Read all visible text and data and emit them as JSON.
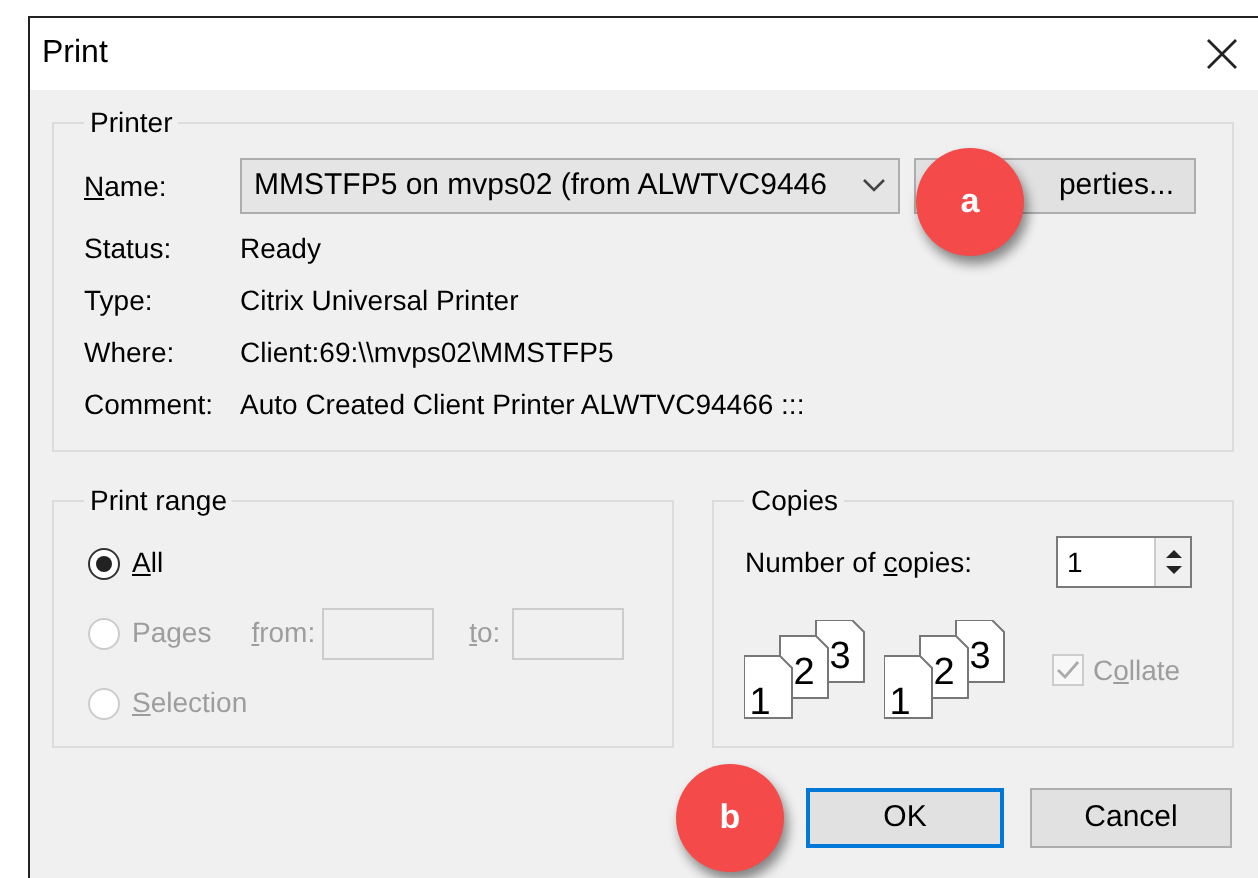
{
  "window": {
    "title": "Print"
  },
  "printer": {
    "title": "Printer",
    "name_label": {
      "key": "N",
      "post": "ame:"
    },
    "name_value": "MMSTFP5 on mvps02 (from ALWTVC9446",
    "properties_button": "perties...",
    "details": [
      {
        "label": "Status:",
        "value": "Ready"
      },
      {
        "label": "Type:",
        "value": "Citrix Universal Printer"
      },
      {
        "label": "Where:",
        "value": "Client:69:\\\\mvps02\\MMSTFP5"
      },
      {
        "label": "Comment:",
        "value": "Auto Created Client Printer ALWTVC94466 :::"
      }
    ]
  },
  "print_range": {
    "title": "Print range",
    "options": [
      {
        "kind": "all",
        "label": {
          "key": "A",
          "post": "ll"
        },
        "selected": true,
        "disabled": false
      },
      {
        "kind": "pages",
        "label": {
          "pre": "Pa",
          "key": "g",
          "post": "es"
        },
        "selected": false,
        "disabled": true
      },
      {
        "kind": "selection",
        "label": {
          "key": "S",
          "post": "election"
        },
        "selected": false,
        "disabled": true
      }
    ],
    "from_label": {
      "key": "f",
      "post": "rom:"
    },
    "to_label": {
      "key": "t",
      "post": "o:"
    }
  },
  "copies": {
    "title": "Copies",
    "count_label": {
      "pre": "Number of ",
      "key": "c",
      "post": "opies:"
    },
    "count": "1",
    "collate_stacks": [
      [
        "1",
        "2",
        "3"
      ],
      [
        "1",
        "2",
        "3"
      ]
    ],
    "collate": {
      "label": {
        "pre": "C",
        "key": "o",
        "post": "llate"
      },
      "checked": true,
      "disabled": true
    }
  },
  "buttons": [
    {
      "label": "OK",
      "default": true
    },
    {
      "label": "Cancel",
      "default": false
    }
  ],
  "annotations": [
    {
      "label": "a"
    },
    {
      "label": "b"
    }
  ]
}
